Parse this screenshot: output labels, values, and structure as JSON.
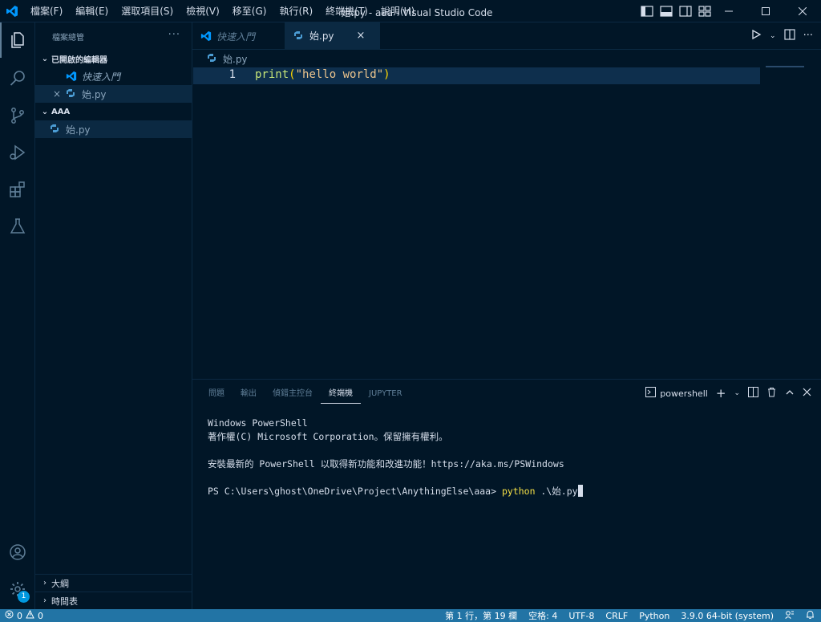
{
  "titlebar": {
    "menu": [
      "檔案(F)",
      "編輯(E)",
      "選取項目(S)",
      "檢視(V)",
      "移至(G)",
      "執行(R)",
      "終端機(T)",
      "說明(H)"
    ],
    "title": "始.py - aaa - Visual Studio Code"
  },
  "activity": {
    "icons": [
      "explorer-icon",
      "search-icon",
      "source-control-icon",
      "run-debug-icon",
      "extensions-icon",
      "testing-icon",
      "account-icon",
      "settings-gear-icon"
    ],
    "settings_badge": "1"
  },
  "sidebar": {
    "header": "檔案總管",
    "more": "···",
    "open_editors": {
      "title": "已開啟的編輯器",
      "items": [
        {
          "label": "快速入門",
          "icon": "vscode-icon"
        },
        {
          "label": "始.py",
          "icon": "python-icon",
          "close": "×"
        }
      ]
    },
    "folder": {
      "title": "AAA",
      "items": [
        {
          "label": "始.py",
          "icon": "python-icon"
        }
      ]
    },
    "outline": "大綱",
    "timeline": "時間表"
  },
  "editor": {
    "tabs": [
      {
        "label": "快速入門",
        "icon": "vscode-icon",
        "active": false
      },
      {
        "label": "始.py",
        "icon": "python-icon",
        "active": true,
        "close": "×"
      }
    ],
    "breadcrumb": "始.py",
    "lines": [
      {
        "number": "1",
        "fn": "print",
        "open": "(",
        "str": "\"hello world\"",
        "close": ")"
      }
    ]
  },
  "panel": {
    "tabs": [
      "問題",
      "輸出",
      "偵錯主控台",
      "終端機",
      "JUPYTER"
    ],
    "active_tab": "終端機",
    "shell": "powershell",
    "terminal": {
      "line1": "Windows PowerShell",
      "line2": "著作權(C) Microsoft Corporation。保留擁有權利。",
      "line3": "安裝最新的 PowerShell 以取得新功能和改進功能！https://aka.ms/PSWindows",
      "prompt": "PS C:\\Users\\ghost\\OneDrive\\Project\\AnythingElse\\aaa> ",
      "command": "python",
      "args": " .\\始.py"
    }
  },
  "statusbar": {
    "errors": "0",
    "warnings": "0",
    "position": "第 1 行，第 19 欄",
    "spaces": "空格: 4",
    "encoding": "UTF-8",
    "eol": "CRLF",
    "language": "Python",
    "interpreter": "3.9.0 64-bit (system)"
  },
  "colors": {
    "background": "#011627",
    "statusbar": "#2274a5",
    "line_highlight": "#0e2f4d",
    "function": "#c5e478",
    "string": "#ecc48d",
    "bracket": "#ffd700"
  }
}
